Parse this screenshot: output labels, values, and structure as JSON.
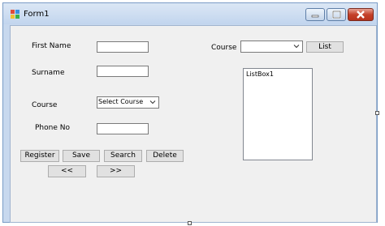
{
  "window": {
    "title": "Form1",
    "icon": "winforms-app-icon"
  },
  "caption_buttons": {
    "minimize": "minimize-icon",
    "maximize": "maximize-icon",
    "close": "close-icon"
  },
  "form": {
    "first_name_label": "First Name",
    "surname_label": "Surname",
    "course_label": "Course",
    "course_select_value": "Select Course",
    "phone_label": "Phone No",
    "first_name_value": "",
    "surname_value": "",
    "phone_value": ""
  },
  "buttons": {
    "register": "Register",
    "save": "Save",
    "search": "Search",
    "delete": "Delete",
    "prev": "<<",
    "next": ">>"
  },
  "right_panel": {
    "course_label": "Course",
    "course_select_value": "",
    "list_button": "List",
    "listbox_items": [
      "ListBox1"
    ]
  }
}
